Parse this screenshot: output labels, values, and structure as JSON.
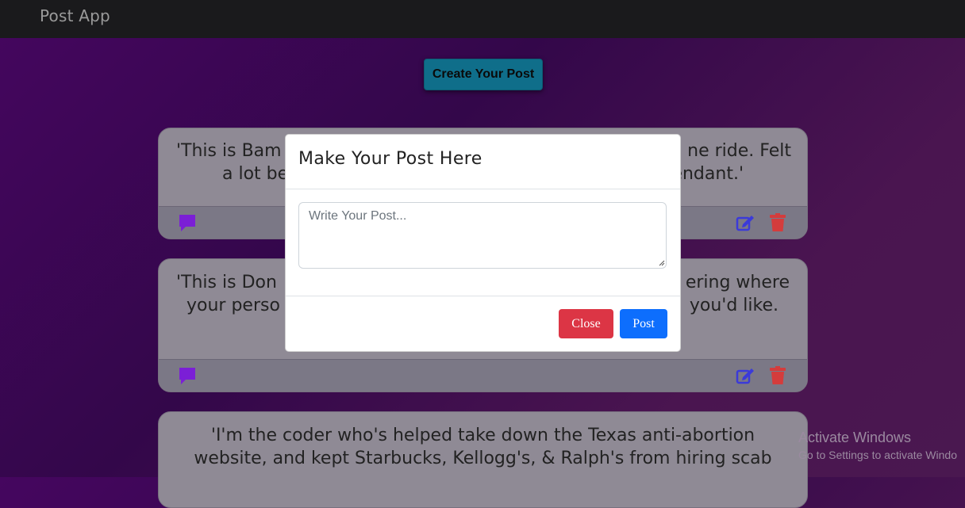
{
  "navbar": {
    "brand": "Post App"
  },
  "main": {
    "create_button": "Create Your Post"
  },
  "posts": [
    {
      "text_visible_left": "'This is Bam",
      "text_visible_right": "ne ride. Felt",
      "line2_left": "a lot be",
      "line2_right": "endant.'"
    },
    {
      "text_visible_left": "'This is Don",
      "text_visible_right": "ering where",
      "line2_left": "your perso",
      "line2_right": "you'd like."
    },
    {
      "line1": "'I'm the coder who's helped take down the Texas anti-abortion",
      "line2": "website, and kept Starbucks, Kellogg's, & Ralph's from hiring scab"
    }
  ],
  "icons": {
    "comment": "comment-icon",
    "edit": "edit-icon",
    "delete": "trash-icon"
  },
  "colors": {
    "comment": "#7b1fd6",
    "edit": "#3b3ad9",
    "delete": "#d43c3c",
    "close": "#dc3545",
    "post": "#0d6efd"
  },
  "modal": {
    "title": "Make Your Post Here",
    "placeholder": "Write Your Post...",
    "value": "",
    "close_label": "Close",
    "post_label": "Post"
  },
  "watermark": {
    "title": "Activate Windows",
    "subtitle": "Go to Settings to activate Windo"
  }
}
